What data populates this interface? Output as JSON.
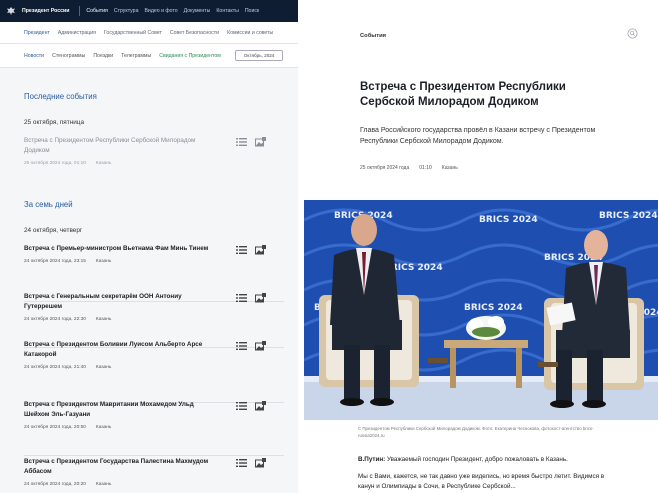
{
  "header": {
    "brand": "Президент России",
    "nav": [
      "События",
      "Структура",
      "Видео и фото",
      "Документы",
      "Контакты",
      "Поиск"
    ],
    "active_nav": 0
  },
  "subnav": {
    "items": [
      "Президент",
      "Администрация",
      "Государственный Совет",
      "Совет Безопасности",
      "Комиссии и советы"
    ],
    "active": 0
  },
  "tabs": {
    "items": [
      "Новости",
      "Стенограммы",
      "Поездки",
      "Телеграммы",
      "Свидания с Президентом"
    ],
    "active": 0,
    "green": 4,
    "date_value": "Октябрь, 2024"
  },
  "latest": {
    "title": "Последние события",
    "day": "25 октября, пятница",
    "items": [
      {
        "title": "Встреча с Президентом Республики Сербской Милорадом Додиком",
        "date": "25 октября 2024 года, 01:10",
        "place": "Казань"
      }
    ]
  },
  "week": {
    "title": "За семь дней",
    "day": "24 октября, четверг",
    "items": [
      {
        "title": "Встреча с Премьер-министром Вьетнама Фам Минь Тинем",
        "date": "24 октября 2024 года, 23:15",
        "place": "Казань"
      },
      {
        "title": "Встреча с Генеральным секретарём ООН Антониу Гутеррешем",
        "date": "24 октября 2024 года, 22:30",
        "place": "Казань"
      },
      {
        "title": "Встреча с Президентом Боливии Луисом Альберто Арсе Катакорой",
        "date": "24 октября 2024 года, 21:40",
        "place": "Казань"
      },
      {
        "title": "Встреча с Президентом Мавритании Мохамедом Ульд Шейхом Эль-Газуани",
        "date": "24 октября 2024 года, 20:50",
        "place": "Казань"
      },
      {
        "title": "Встреча с Президентом Государства Палестина Махмудом Аббасом",
        "date": "24 октября 2024 года, 20:20",
        "place": "Казань"
      }
    ]
  },
  "article": {
    "crumb": "События",
    "title": "Встреча с Президентом Республики Сербской Милорадом Додиком",
    "lead": "Глава Российского государства провёл в Казани встречу с Президентом Республики Сербской Милорадом Додиком.",
    "date": "25 октября 2024 года",
    "time": "01:10",
    "place": "Казань",
    "photo_banner": "BRICS 2024",
    "caption": "С Президентом Республики Сербской Милорадом Додиком. Фото: Екатерина Чеснокова, фотохост-агентство brics-russia2024.ru",
    "speaker": "В.Путин:",
    "para1": "Уважаемый господин Президент, добро пожаловать в Казань.",
    "para2": "Мы с Вами, кажется, не так давно уже виделись, но время быстро летит. Видимся в канун и Олимпиады в Сочи, в Республике Сербской..."
  },
  "colors": {
    "topbar": "#0f1d33",
    "accent_blue": "#2b5c9e",
    "accent_green": "#2e8b57",
    "photo_bg": "#1e4fb0"
  }
}
